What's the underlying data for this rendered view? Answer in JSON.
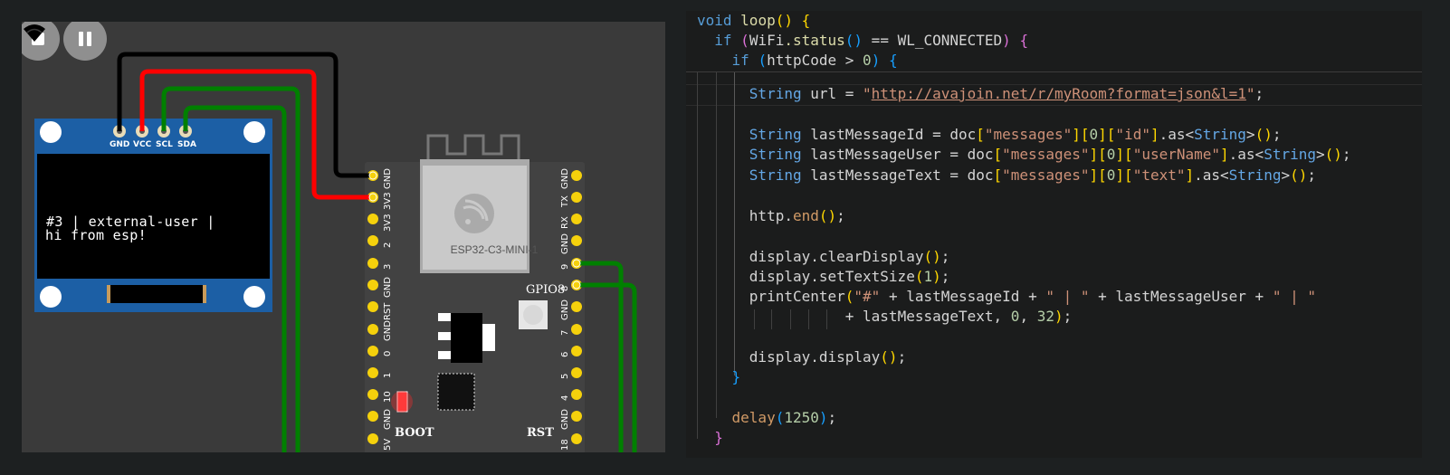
{
  "simulator": {
    "controls": {
      "stop_icon": "stop-icon",
      "pause_icon": "pause-icon",
      "wifi_icon": "wifi-icon"
    },
    "oled": {
      "pins": [
        "GND",
        "VCC",
        "SCL",
        "SDA"
      ],
      "line1": "#3 | external-user |",
      "line2": "hi from esp!"
    },
    "board": {
      "module_name": "ESP32-C3-MINI-1",
      "gpio_label": "GPIO8",
      "boot_label": "BOOT",
      "rst_label": "RST",
      "left_pins": [
        "GND",
        "3V3",
        "3V3",
        "2",
        "3",
        "GND",
        "RST",
        "GND",
        "0",
        "1",
        "10",
        "GND",
        "5V"
      ],
      "right_pins": [
        "GND",
        "TX",
        "RX",
        "GND",
        "9",
        "8",
        "GND",
        "7",
        "6",
        "5",
        "4",
        "GND",
        "18"
      ]
    },
    "wire_colors": {
      "gnd": "#000000",
      "vcc": "#ff0000",
      "data": "#008000"
    }
  },
  "code": {
    "l1": {
      "void": "void",
      "name": "loop",
      "parens": "()",
      "brace": "{"
    },
    "l2": {
      "if": "if",
      "open": "(",
      "obj": "WiFi",
      "method": ".status",
      "call": "()",
      "op": " == ",
      "const": "WL_CONNECTED",
      "close": ")",
      "brace": "{"
    },
    "l3": {
      "if": "if",
      "open": "(",
      "var": "httpCode",
      "op": " > ",
      "num": "0",
      "close": ")",
      "brace": "{"
    },
    "l4": {
      "type": "String",
      "decl": " url = ",
      "q1": "\"",
      "url": "http://avajoin.net/r/myRoom?format=json&l=1",
      "q2": "\"",
      "semi": ";"
    },
    "l5": {
      "type": "String",
      "decl": " lastMessageId = doc",
      "b1": "[",
      "s1": "\"messages\"",
      "b2": "]",
      "b3": "[",
      "n": "0",
      "b4": "]",
      "b5": "[",
      "s2": "\"id\"",
      "b6": "]",
      "as": ".as<",
      "t": "String",
      "gt": ">",
      "call": "()",
      "semi": ";"
    },
    "l6": {
      "type": "String",
      "decl": " lastMessageUser = doc",
      "b1": "[",
      "s1": "\"messages\"",
      "b2": "]",
      "b3": "[",
      "n": "0",
      "b4": "]",
      "b5": "[",
      "s2": "\"userName\"",
      "b6": "]",
      "as": ".as<",
      "t": "String",
      "gt": ">",
      "call": "()",
      "semi": ";"
    },
    "l7": {
      "type": "String",
      "decl": " lastMessageText = doc",
      "b1": "[",
      "s1": "\"messages\"",
      "b2": "]",
      "b3": "[",
      "n": "0",
      "b4": "]",
      "b5": "[",
      "s2": "\"text\"",
      "b6": "]",
      "as": ".as<",
      "t": "String",
      "gt": ">",
      "call": "()",
      "semi": ";"
    },
    "l8": {
      "obj": "http.",
      "method": "end",
      "call": "()",
      "semi": ";"
    },
    "l9": {
      "obj": "display.clearDisplay",
      "call": "()",
      "semi": ";"
    },
    "l10": {
      "obj": "display.setTextSize",
      "open": "(",
      "num": "1",
      "close": ")",
      "semi": ";"
    },
    "l11": {
      "fn": "printCenter",
      "open": "(",
      "s1": "\"#\"",
      "a": " + lastMessageId + ",
      "s2": "\" | \"",
      "b": " + lastMessageUser + ",
      "s3": "\" | \""
    },
    "l12": {
      "a": "+ lastMessageText, ",
      "n1": "0",
      "c": ", ",
      "n2": "32",
      "close": ")",
      "semi": ";"
    },
    "l13": {
      "obj": "display.display",
      "call": "()",
      "semi": ";"
    },
    "l14": {
      "brace": "}"
    },
    "l15": {
      "fn": "delay",
      "open": "(",
      "num": "1250",
      "close": ")",
      "semi": ";"
    },
    "l16": {
      "brace": "}"
    }
  }
}
